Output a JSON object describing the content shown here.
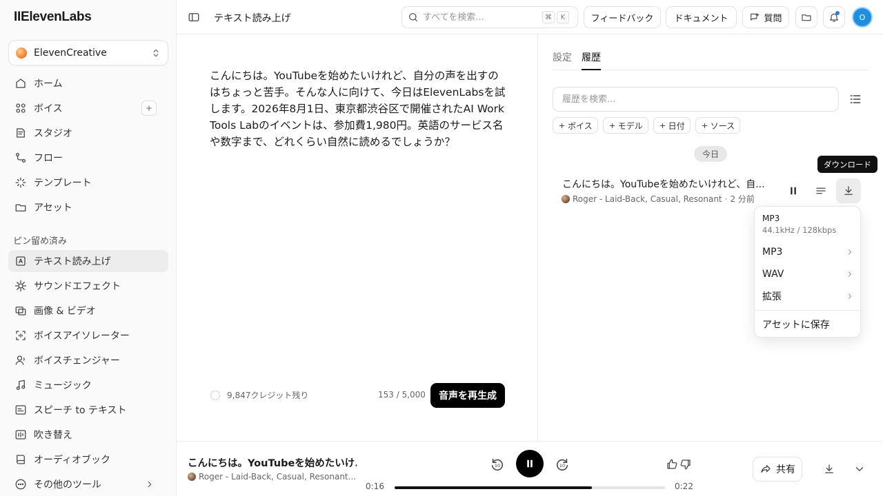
{
  "sidebar": {
    "logo": "IIElevenLabs",
    "workspace": "ElevenCreative",
    "main_items": [
      {
        "label": "ホーム"
      },
      {
        "label": "ボイス"
      },
      {
        "label": "スタジオ"
      },
      {
        "label": "フロー"
      },
      {
        "label": "テンプレート"
      },
      {
        "label": "アセット"
      }
    ],
    "pinned_label": "ピン留め済み",
    "pinned_items": [
      {
        "label": "テキスト読み上げ"
      },
      {
        "label": "サウンドエフェクト"
      },
      {
        "label": "画像 & ビデオ"
      },
      {
        "label": "ボイスアイソレーター"
      },
      {
        "label": "ボイスチェンジャー"
      },
      {
        "label": "ミュージック"
      },
      {
        "label": "スピーチ to テキスト"
      },
      {
        "label": "吹き替え"
      },
      {
        "label": "オーディオブック"
      },
      {
        "label": "その他のツール"
      }
    ]
  },
  "header": {
    "title": "テキスト読み上げ",
    "search_placeholder": "すべてを検索...",
    "kbd_cmd": "⌘",
    "kbd_k": "K",
    "feedback": "フィードバック",
    "docs": "ドキュメント",
    "ask": "質問",
    "avatar_initial": "O"
  },
  "editor": {
    "text": "こんにちは。YouTubeを始めたいけれど、自分の声を出すのはちょっと苦手。そんな人に向けて、今日はElevenLabsを試します。2026年8月1日、東京都渋谷区で開催されたAI Work Tools Labのイベントは、参加費1,980円。英語のサービス名や数字まで、どれくらい自然に読めるでしょうか？",
    "credits": "9,847クレジット残り",
    "char_count": "153 / 5,000",
    "regenerate": "音声を再生成"
  },
  "panel": {
    "tabs": [
      {
        "label": "設定"
      },
      {
        "label": "履歴"
      }
    ],
    "search_placeholder": "履歴を検索...",
    "filters": [
      {
        "label": "ボイス"
      },
      {
        "label": "モデル"
      },
      {
        "label": "日付"
      },
      {
        "label": "ソース"
      }
    ],
    "day_label": "今日",
    "item": {
      "title": "こんにちは。YouTubeを始めたいけれど、自...",
      "voice": "Roger - Laid-Back, Casual, Resonant",
      "sep": "·",
      "time": "2 分前"
    },
    "tooltip": "ダウンロード",
    "dropdown": {
      "header": "MP3",
      "sub": "44.1kHz / 128kbps",
      "items": [
        {
          "label": "MP3"
        },
        {
          "label": "WAV"
        },
        {
          "label": "拡張"
        }
      ],
      "save": "アセットに保存"
    }
  },
  "player": {
    "title": "こんにちは。YouTubeを始めたいけ...",
    "voice": "Roger - Laid-Back, Casual, Resonant...",
    "current": "0:16",
    "total": "0:22",
    "progress": 0.73,
    "share": "共有",
    "skip_seconds": "10"
  },
  "colors": {
    "accent_blue": "#1e8fe0",
    "primary_button": "#000000",
    "active_nav": "#ededed"
  }
}
